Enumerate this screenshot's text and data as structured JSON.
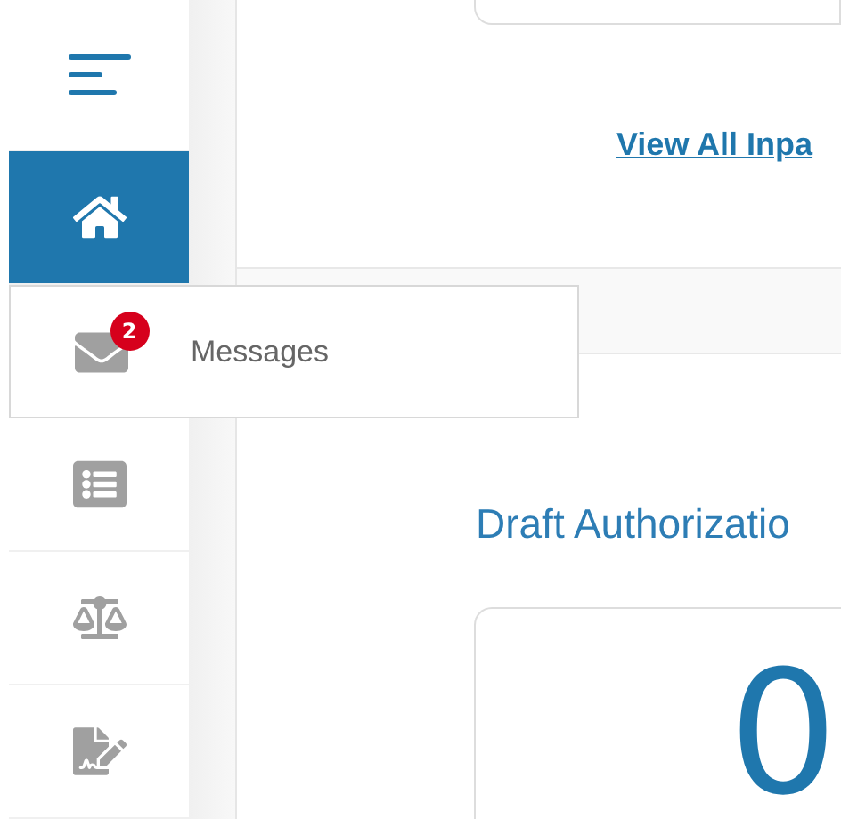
{
  "sidebar": {
    "items": [
      {
        "selected": true
      },
      {
        "selected": false,
        "badge": "2",
        "flyout": {
          "label": "Messages"
        }
      },
      {
        "selected": false
      },
      {
        "selected": false
      },
      {
        "selected": false
      }
    ]
  },
  "main": {
    "link": "View All Inpa",
    "section_title": "Draft Authorizatio",
    "count": "0"
  }
}
